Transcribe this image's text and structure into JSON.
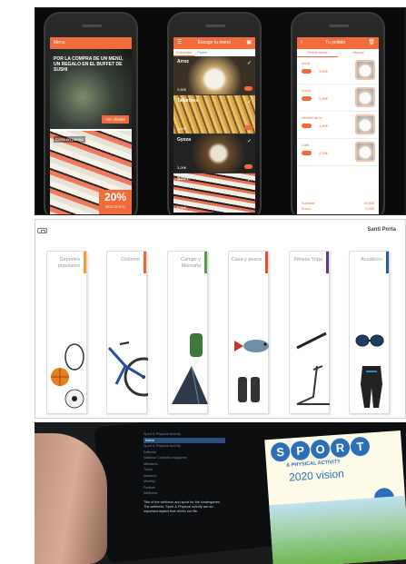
{
  "phones": {
    "home": {
      "title": "Menu",
      "hero_text": "POR LA COMPRA DE UN MENÚ, UN REGALO EN EL BUFFET DE SUSHI",
      "cta": "Ver ofertas",
      "sushi_caption": "Cena en pareja",
      "discount": "20%",
      "discount_label": "DESCUENTO"
    },
    "menu": {
      "title": "Escoge tu menú",
      "tabs": [
        "Entrantes",
        "Platos"
      ],
      "items": [
        {
          "name": "Arroz",
          "price": "3,80€"
        },
        {
          "name": "Tallarines",
          "price": "4,50€"
        },
        {
          "name": "Gyoza",
          "price": "3,00€"
        },
        {
          "name": "Sushi",
          "price": "5,50€"
        }
      ]
    },
    "cart": {
      "title": "Tu pedido",
      "tabs": [
        "Pedido actual",
        "Historial"
      ],
      "rows": [
        {
          "name": "Arroz",
          "price": "3,80€"
        },
        {
          "name": "Sushi",
          "price": "5,50€"
        },
        {
          "name": "Helado de té",
          "price": "4,50€"
        },
        {
          "name": "Café",
          "price": "2,00€"
        }
      ],
      "subtotal_label": "Subtotal",
      "subtotal": "15,80€",
      "total_label": "Envío",
      "total": "2,00€"
    }
  },
  "catalog": {
    "user": "Santi Porta",
    "categories": [
      {
        "label": "Deportes populares",
        "color": "#f0a030"
      },
      {
        "label": "Ciclismo",
        "color": "#e86a3a"
      },
      {
        "label": "Campo y Montaña",
        "color": "#4aa34a"
      },
      {
        "label": "Caza y pesca",
        "color": "#e0532a"
      },
      {
        "label": "Fitness Yoga",
        "color": "#5a3a8a"
      },
      {
        "label": "Acuáticos",
        "color": "#2a5aa8"
      }
    ]
  },
  "tablet": {
    "sidebar": [
      "Sport & Physical Activity",
      "Índice",
      "Sport & Physical Activity",
      "Editorial",
      "National Contents magazine",
      "Ministerio",
      "Teach",
      "Ilustrado",
      "Mobility",
      "Podium",
      "Wellness"
    ],
    "selected_index": 1,
    "note": "Title of the wellness and sport for the kindergarten. The wellness, Sport & Physical activity are an important aspect that drives our life.",
    "magazine_title": [
      "S",
      "P",
      "O",
      "R",
      "T"
    ],
    "magazine_subtitle": "& PHYSICAL ACTIVITY",
    "magazine_headline": "2020 vision"
  },
  "colors": {
    "accent": "#f26b3a",
    "magazine_blue": "#2c6fb8"
  }
}
